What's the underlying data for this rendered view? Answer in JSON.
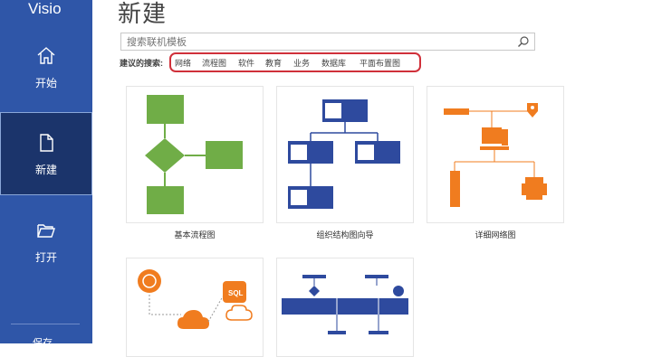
{
  "app": {
    "name": "Visio"
  },
  "sidebar": {
    "items": [
      {
        "label": "开始",
        "icon": "home-icon"
      },
      {
        "label": "新建",
        "icon": "new-document-icon",
        "active": true
      },
      {
        "label": "打开",
        "icon": "open-folder-icon"
      }
    ],
    "partial_item": "保存"
  },
  "page": {
    "title": "新建"
  },
  "search": {
    "placeholder": "搜索联机模板",
    "value": "",
    "icon": "search-icon"
  },
  "suggested": {
    "label": "建议的搜索:",
    "items": [
      "网络",
      "流程图",
      "软件",
      "教育",
      "业务",
      "数据库",
      "平面布置图"
    ]
  },
  "templates": [
    {
      "label": "基本流程图"
    },
    {
      "label": "组织结构图向导"
    },
    {
      "label": "详细网络图"
    },
    {
      "label": "",
      "badge": "SQL"
    },
    {
      "label": ""
    }
  ],
  "colors": {
    "sidebar": "#2f56a8",
    "sidebar_active": "#1b346b",
    "flow_green": "#70ad47",
    "org_blue": "#2e4a9e",
    "network_orange": "#f07c1f",
    "highlight_red": "#d0303a"
  }
}
